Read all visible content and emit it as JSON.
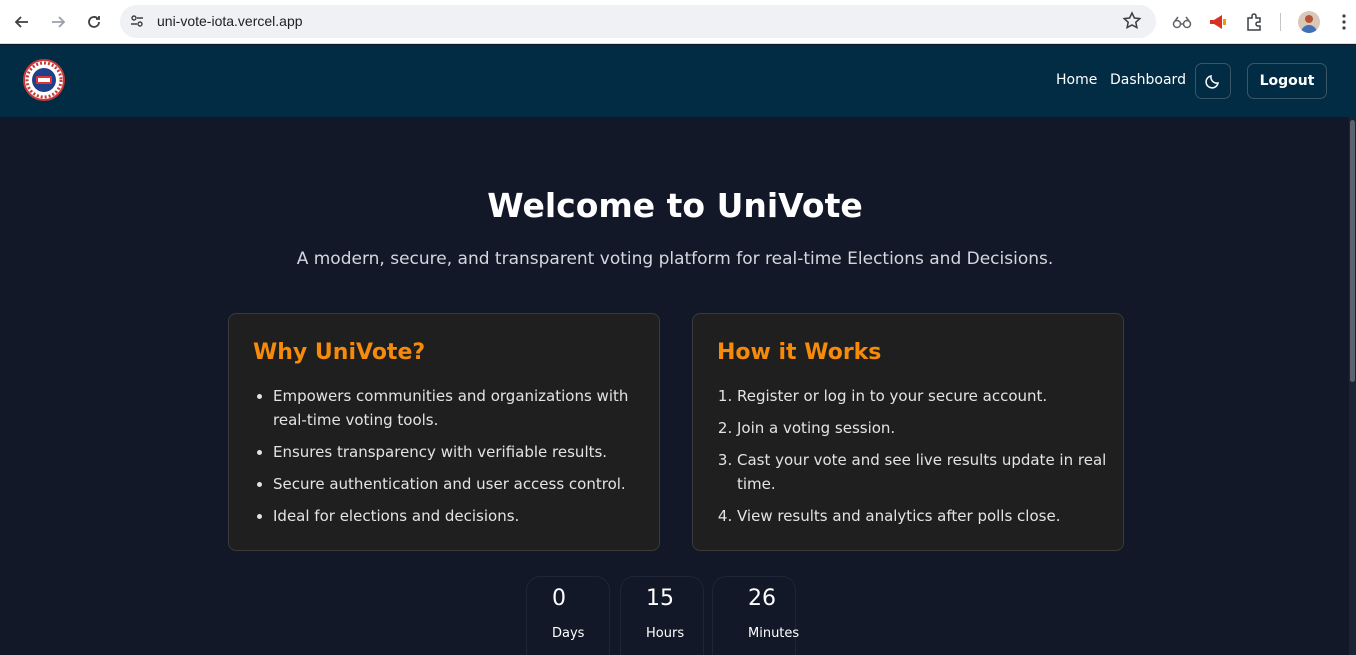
{
  "browser": {
    "url": "uni-vote-iota.vercel.app"
  },
  "nav": {
    "home": "Home",
    "dashboard": "Dashboard",
    "logout": "Logout",
    "theme_icon": "moon-icon"
  },
  "hero": {
    "title": "Welcome to UniVote",
    "subtitle": "A modern, secure, and transparent voting platform for real-time Elections and Decisions."
  },
  "why": {
    "title": "Why UniVote?",
    "items": [
      "Empowers communities and organizations with real-time voting tools.",
      "Ensures transparency with verifiable results.",
      "Secure authentication and user access control.",
      "Ideal for elections and decisions."
    ]
  },
  "how": {
    "title": "How it Works",
    "steps": [
      "Register or log in to your secure account.",
      "Join a voting session.",
      "Cast your vote and see live results update in real time.",
      "View results and analytics after polls close."
    ]
  },
  "countdown": {
    "days": "0",
    "days_label": "Days",
    "hours": "15",
    "hours_label": "Hours",
    "minutes": "26",
    "minutes_label": "Minutes"
  },
  "colors": {
    "navbar": "#022b44",
    "page_bg": "#121827",
    "accent": "#f58a0b"
  }
}
